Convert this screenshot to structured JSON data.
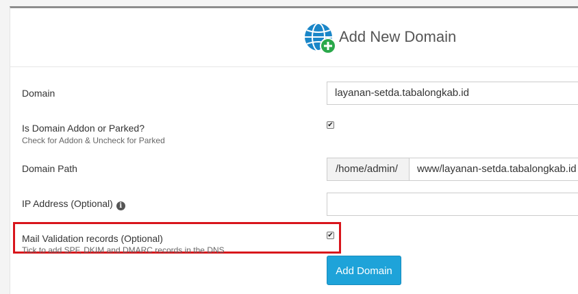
{
  "header": {
    "title": "Add New Domain",
    "icon": "globe-add-icon"
  },
  "form": {
    "domain": {
      "label": "Domain",
      "value": "layanan-setda.tabalongkab.id"
    },
    "addon_parked": {
      "label": "Is Domain Addon or Parked?",
      "help": "Check for Addon & Uncheck for Parked",
      "checked": true
    },
    "domain_path": {
      "label": "Domain Path",
      "prefix": "/home/admin/",
      "value": "www/layanan-setda.tabalongkab.id"
    },
    "ip_address": {
      "label": "IP Address (Optional)",
      "value": "",
      "info_icon": "info-icon"
    },
    "mail_validation": {
      "label": "Mail Validation records (Optional)",
      "help": "Tick to add SPF, DKIM and DMARC records in the DNS",
      "checked": true
    },
    "submit_label": "Add Domain"
  },
  "colors": {
    "accent": "#1ea3d9",
    "highlight": "#d8141b",
    "globe": "#1a86c8",
    "plus": "#2aa84a"
  }
}
